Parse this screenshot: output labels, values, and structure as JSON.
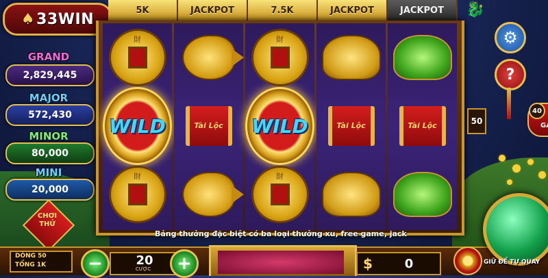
{
  "brand": {
    "logo_text": "33WIN"
  },
  "line_bets": [
    {
      "label": "5K",
      "style": "gold"
    },
    {
      "label": "JACKPOT",
      "style": "gold"
    },
    {
      "label": "7.5K",
      "style": "gold"
    },
    {
      "label": "JACKPOT",
      "style": "gold"
    },
    {
      "label": "JACKPOT",
      "style": "dark"
    }
  ],
  "jackpots": {
    "grand": {
      "label": "GRAND",
      "value": "2,829,445",
      "color": "#f06ad8"
    },
    "major": {
      "label": "MAJOR",
      "value": "572,430",
      "color": "#6ad0ff"
    },
    "minor": {
      "label": "MINOR",
      "value": "80,000",
      "color": "#7cf07a"
    },
    "mini": {
      "label": "MINI",
      "value": "20,000",
      "color": "#6ad0ff"
    }
  },
  "reels": [
    [
      "coin",
      "wild",
      "coin"
    ],
    [
      "goldfish",
      "scroll",
      "goldfish"
    ],
    [
      "coin",
      "wild",
      "coin"
    ],
    [
      "gold-toad",
      "scroll",
      "gold-toad"
    ],
    [
      "jade-toad",
      "scroll",
      "jade-toad"
    ]
  ],
  "symbols": {
    "wild_text": "WILD",
    "scroll_text": "Tài Lộc"
  },
  "lines_count": "50",
  "caption": "Bảng thưởng đặc biệt có ba loại thưởng xu, free game, jack",
  "demo_label": "CHƠI THỬ",
  "controls": {
    "lines_label": "DÒNG 50",
    "total_label": "TỔNG 1K",
    "bet_value": "20",
    "bet_label": "CƯỢC",
    "minus": "−",
    "plus": "+",
    "win_currency": "$",
    "win_value": "0",
    "spin_hint": "GIỮ ĐỂ TỰ QUAY",
    "side_badge_number": "40",
    "side_badge_text": "GA"
  },
  "icons": [
    "settings-gear-icon",
    "help-question-icon",
    "dragon-ornament-icon",
    "spin-orb-icon"
  ]
}
